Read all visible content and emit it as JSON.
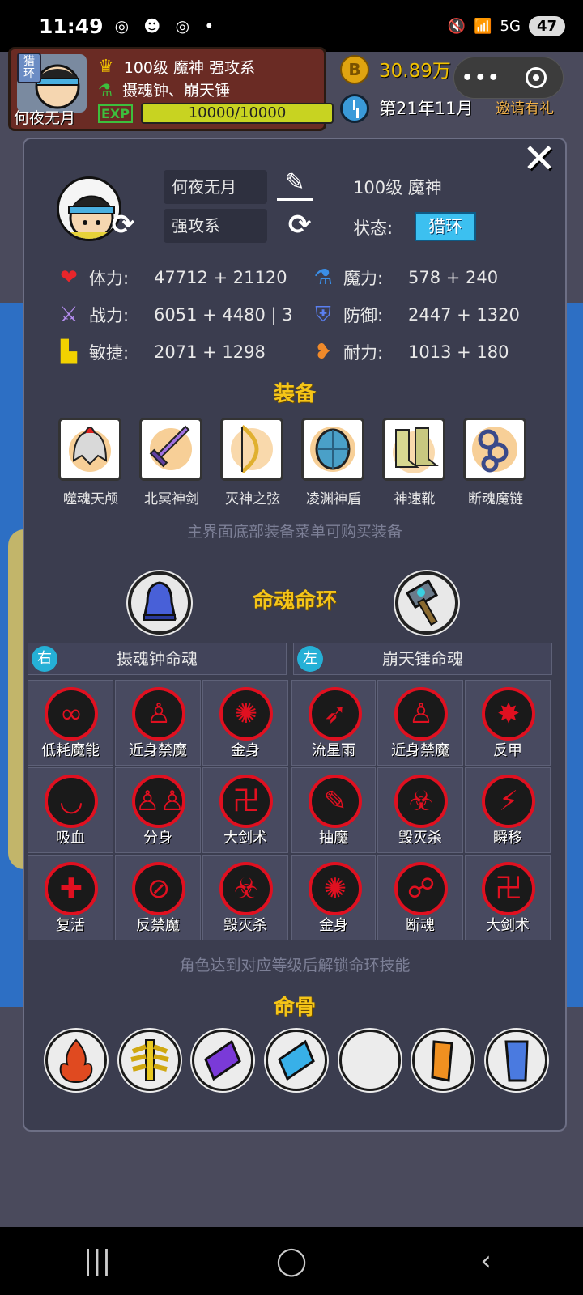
{
  "status_bar": {
    "time": "11:49",
    "notifications": "◎ ☻ ◎ •",
    "network": "5G",
    "battery": "47"
  },
  "hud": {
    "badge": "猎环",
    "player_name": "何夜无月",
    "line1": "100级 魔神 强攻系",
    "line2": "摄魂钟、崩天锤",
    "exp_icon": "EXP",
    "hp": "10000/10000",
    "coins": "30.89万",
    "date": "第21年11月",
    "invite": "邀请有礼"
  },
  "profile": {
    "name": "何夜无月",
    "class": "强攻系",
    "level": "100级 魔神",
    "state_label": "状态:",
    "state_value": "猎环"
  },
  "stats": [
    {
      "icon": "heart-icon",
      "label": "体力:",
      "value": "47712 + 21120",
      "color": "#e8262b"
    },
    {
      "icon": "potion-icon",
      "label": "魔力:",
      "value": "578 + 240",
      "color": "#3a8ee6"
    },
    {
      "icon": "sword-icon",
      "label": "战力:",
      "value": "6051 + 4480 | 3",
      "color": "#b58df0"
    },
    {
      "icon": "shield-icon",
      "label": "防御:",
      "value": "2447 + 1320",
      "color": "#5a7ff0"
    },
    {
      "icon": "boot-icon",
      "label": "敏捷:",
      "value": "2071 + 1298",
      "color": "#f2d200"
    },
    {
      "icon": "heart-plus-icon",
      "label": "耐力:",
      "value": "1013 + 180",
      "color": "#f08a2a"
    }
  ],
  "equipment_title": "装备",
  "equipment": [
    {
      "name": "噬魂天颅",
      "icon": "helmet-icon"
    },
    {
      "name": "北冥神剑",
      "icon": "sword-icon"
    },
    {
      "name": "灭神之弦",
      "icon": "bow-icon"
    },
    {
      "name": "凌渊神盾",
      "icon": "shield-icon"
    },
    {
      "name": "神速靴",
      "icon": "boots-icon"
    },
    {
      "name": "断魂魔链",
      "icon": "chain-icon"
    }
  ],
  "equipment_hint": "主界面底部装备菜单可购买装备",
  "soul_ring_title": "命魂命环",
  "right_header": {
    "side": "右",
    "title": "摄魂钟命魂"
  },
  "left_header": {
    "side": "左",
    "title": "崩天锤命魂"
  },
  "skills": [
    "低耗魔能",
    "近身禁魔",
    "金身",
    "流星雨",
    "近身禁魔",
    "反甲",
    "吸血",
    "分身",
    "大剑术",
    "抽魔",
    "毁灭杀",
    "瞬移",
    "复活",
    "反禁魔",
    "毁灭杀",
    "金身",
    "断魂",
    "大剑术"
  ],
  "skill_hint": "角色达到对应等级后解锁命环技能",
  "bone_title": "命骨",
  "bones": [
    "fire-bone-icon",
    "yellow-bone-icon",
    "purple-bone-icon",
    "blue-bone-icon",
    "empty-slot",
    "orange-bone-icon",
    "blue-leg-bone-icon"
  ]
}
